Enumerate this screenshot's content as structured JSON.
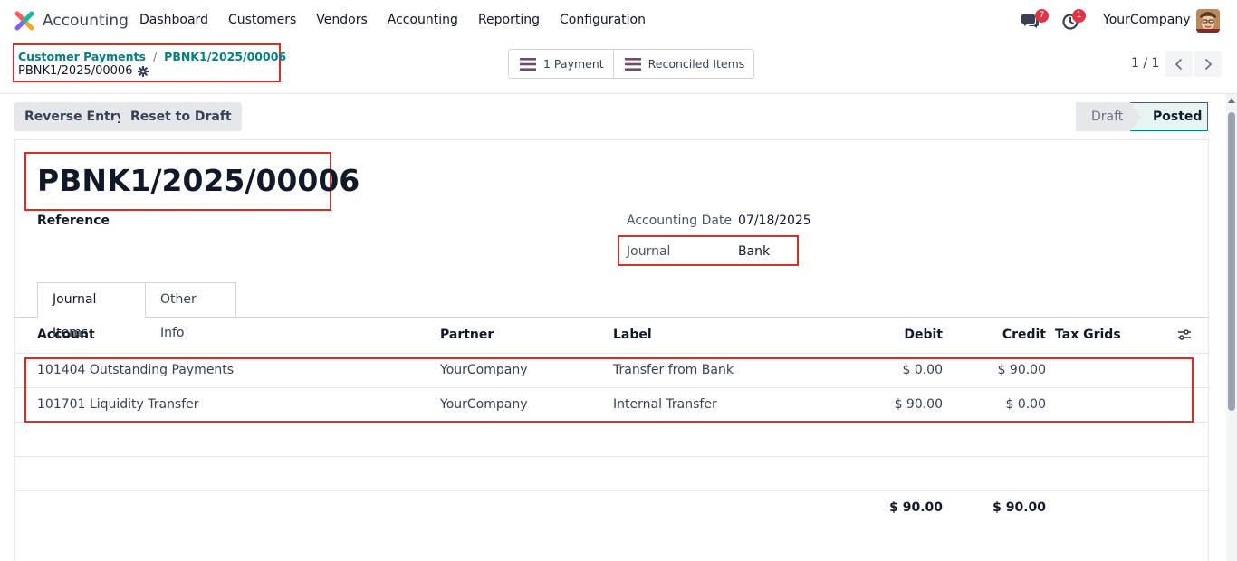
{
  "navbar": {
    "app_name": "Accounting",
    "menu": [
      "Dashboard",
      "Customers",
      "Vendors",
      "Accounting",
      "Reporting",
      "Configuration"
    ],
    "chat_badge": "7",
    "activity_badge": "1",
    "company": "YourCompany"
  },
  "breadcrumb": {
    "parent": "Customer Payments",
    "separator": "/",
    "current": "PBNK1/2025/00006",
    "record": "PBNK1/2025/00006"
  },
  "smart_buttons": {
    "payment": "1 Payment",
    "reconciled": "Reconciled Items"
  },
  "pager": {
    "value": "1 / 1"
  },
  "actions": {
    "reverse": "Reverse Entry",
    "reset": "Reset to Draft"
  },
  "status": {
    "draft": "Draft",
    "posted": "Posted"
  },
  "form": {
    "title": "PBNK1/2025/00006",
    "reference_label": "Reference",
    "accounting_date_label": "Accounting Date",
    "accounting_date": "07/18/2025",
    "journal_label": "Journal",
    "journal": "Bank"
  },
  "tabs": {
    "journal_items": "Journal Items",
    "other_info": "Other Info"
  },
  "table": {
    "headers": {
      "account": "Account",
      "partner": "Partner",
      "label": "Label",
      "debit": "Debit",
      "credit": "Credit",
      "tax_grids": "Tax Grids"
    },
    "rows": [
      {
        "account": "101404 Outstanding Payments",
        "partner": "YourCompany",
        "label": "Transfer from Bank",
        "debit": "$ 0.00",
        "credit": "$ 90.00"
      },
      {
        "account": "101701 Liquidity Transfer",
        "partner": "YourCompany",
        "label": "Internal Transfer",
        "debit": "$ 90.00",
        "credit": "$ 0.00"
      }
    ],
    "totals": {
      "debit": "$ 90.00",
      "credit": "$ 90.00"
    }
  },
  "colors": {
    "brand": "#017e84",
    "highlight": "#d32f2f",
    "badge": "#dc3545"
  }
}
